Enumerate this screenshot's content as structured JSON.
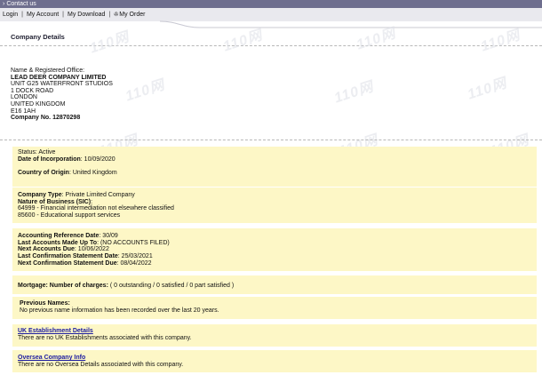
{
  "topbar": {
    "contact": "Contact us"
  },
  "nav": {
    "login": "Login",
    "my_account": "My Account",
    "my_download": "My Download",
    "my_order": "My Order",
    "separator": "|"
  },
  "header": {
    "title": "Company Details"
  },
  "office": {
    "label": "Name & Registered Office:",
    "company_name": "LEAD DEER COMPANY LIMITED",
    "address_lines": [
      "UNIT G25 WATERFRONT STUDIOS",
      "1 DOCK ROAD",
      "LONDON",
      "UNITED KINGDOM",
      "E16 1AH"
    ],
    "company_no_label": "Company No.",
    "company_no": "12870298"
  },
  "status_panel": {
    "status_label": "Status",
    "status_value": ": Active",
    "incorporation_label": "Date of Incorporation",
    "incorporation_value": ": 10/09/2020",
    "origin_label": "Country of Origin",
    "origin_value": ": United Kingdom"
  },
  "type_panel": {
    "type_label": "Company Type",
    "type_value": ": Private Limited Company",
    "sic_label": "Nature of Business (SIC)",
    "sic_colon": ":",
    "sic_items": [
      "64999 - Financial intermediation not elsewhere classified",
      "85600 - Educational support services"
    ]
  },
  "accounts_panel": {
    "rows": [
      {
        "label": "Accounting Reference Date",
        "value": ": 30/09"
      },
      {
        "label": "Last Accounts Made Up To",
        "value": ":  (NO ACCOUNTS FILED)"
      },
      {
        "label": "Next Accounts Due",
        "value": ": 10/06/2022"
      },
      {
        "label": "Last Confirmation Statement Date",
        "value": ": 25/03/2021"
      },
      {
        "label": "Next Confirmation Statement Due",
        "value": ": 08/04/2022"
      }
    ]
  },
  "mortgage_panel": {
    "label": "Mortgage: Number of charges:",
    "value": " ( 0 outstanding / 0 satisfied / 0 part satisfied )"
  },
  "names_panel": {
    "title": "Previous Names:",
    "text": "No previous name information has been recorded over the last 20 years."
  },
  "uk_panel": {
    "link": "UK Establishment Details",
    "text": "There are no UK Establishments associated with this company."
  },
  "oversea_panel": {
    "link": "Oversea Company Info",
    "text": "There are no Oversea Details associated with this company."
  },
  "watermark": "110网",
  "colors": {
    "panel_bg": "#fdf7c6",
    "topbar": "#6e6e8e",
    "link": "#1a1aa0"
  }
}
